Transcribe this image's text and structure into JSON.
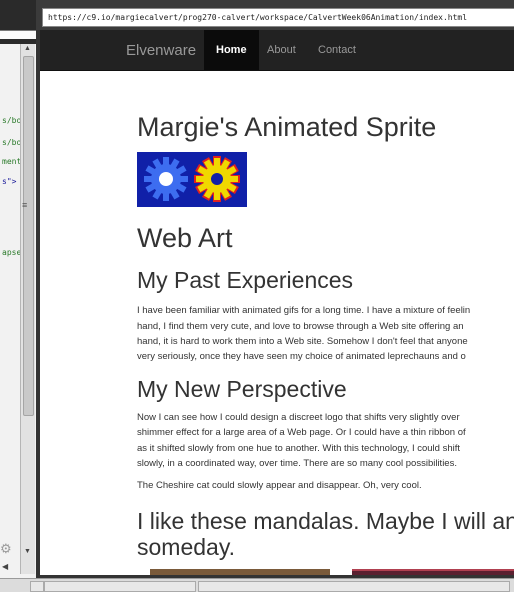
{
  "browser": {
    "url": "https://c9.io/margiecalvert/prog270-calvert/workspace/CalvertWeek06Animation/index.html"
  },
  "editor": {
    "code_lines": [
      "s/bo",
      "s/bo",
      "ment",
      "s\">",
      "apse"
    ],
    "gear_icon": "gear-icon"
  },
  "navbar": {
    "brand": "Elvenware",
    "links": [
      {
        "label": "Home",
        "active": true
      },
      {
        "label": "About",
        "active": false
      },
      {
        "label": "Contact",
        "active": false
      }
    ]
  },
  "page": {
    "title": "Margie's Animated Sprite",
    "section_title": "Web Art",
    "past": {
      "heading": "My Past Experiences",
      "lines": [
        "I have been familiar with animated gifs for a long time. I have a mixture of feelin",
        "hand, I find them very cute, and love to browse through a Web site offering an",
        "hand, it is hard to work them into a Web site. Somehow I don't feel that anyone",
        "very seriously, once they have seen my choice of animated leprechauns and o"
      ]
    },
    "new": {
      "heading": "My New Perspective",
      "lines": [
        "Now I can see how I could design a discreet logo that shifts very slightly over",
        "shimmer effect for a large area of a Web page. Or I could have a thin ribbon of",
        "as it shifted slowly from one hue to another. With this technology, I could shift",
        "slowly, in a coordinated way, over time. There are so many cool possibilities."
      ],
      "cheshire": "The Cheshire cat could slowly appear and disappear. Oh, very cool."
    },
    "mandala": {
      "line1": "I like these mandalas. Maybe I will anin",
      "line2": "someday."
    },
    "colors": {
      "sprite_bg": "#1020a8",
      "gear_left": "#3d6df0",
      "gear_right": "#f0d800",
      "gear_right_outline": "#e02020"
    }
  }
}
